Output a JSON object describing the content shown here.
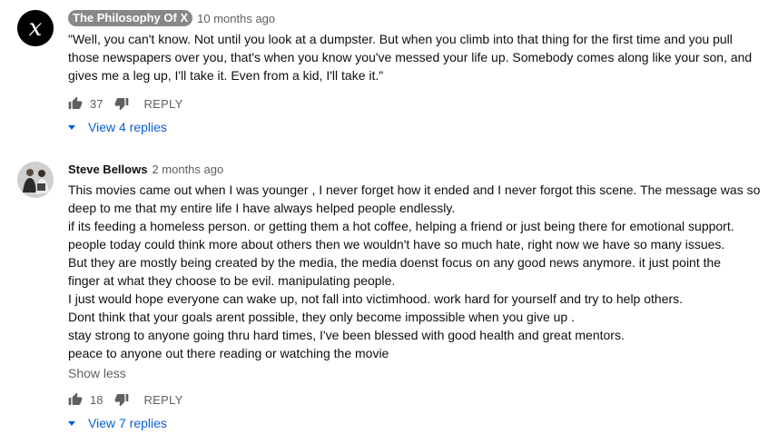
{
  "comments": [
    {
      "author": "The Philosophy Of X",
      "time": "10 months ago",
      "avatar_letter": "x",
      "text_lines": [
        "\"Well, you can't know. Not until you look at a dumpster. But when you climb into that thing for the first time and you pull",
        "those newspapers over you, that's when you know you've messed your life up. Somebody comes along like your son, and",
        "gives me a leg up, I'll take it. Even from a kid, I'll take it.\""
      ],
      "likes": "37",
      "reply_label": "REPLY",
      "view_replies": "View 4 replies"
    },
    {
      "author": "Steve Bellows",
      "time": "2 months ago",
      "text_lines": [
        "This movies came out when I was younger , I never forget how it ended and I never forgot this scene. The message was so",
        "deep to me that  my entire life I have always helped people endlessly.",
        "if its feeding a homeless person. or getting them a hot coffee, helping a friend or just being there for emotional support.",
        "people today could think more about others then we wouldn't have so much hate, right now we have so many issues.",
        "But they are mostly being created by the media, the media doenst focus on any good news anymore.  it just point the",
        "finger at what they choose to be evil. manipulating people.",
        "I just would hope everyone can wake up, not fall into victimhood. work hard for yourself and try to help others.",
        "Dont think that your goals arent possible,  they only become impossible when you give up .",
        "stay strong to anyone going thru hard times,  I've been blessed with good health and great mentors.",
        "peace to anyone out there reading or watching the movie"
      ],
      "show_less": "Show less",
      "likes": "18",
      "reply_label": "REPLY",
      "view_replies": "View 7 replies"
    }
  ],
  "colors": {
    "link_blue": "#065fd4",
    "badge_gray": "#888888",
    "secondary_text": "#606060"
  },
  "icons": [
    "thumb-up-icon",
    "thumb-down-icon",
    "caret-down-icon"
  ]
}
